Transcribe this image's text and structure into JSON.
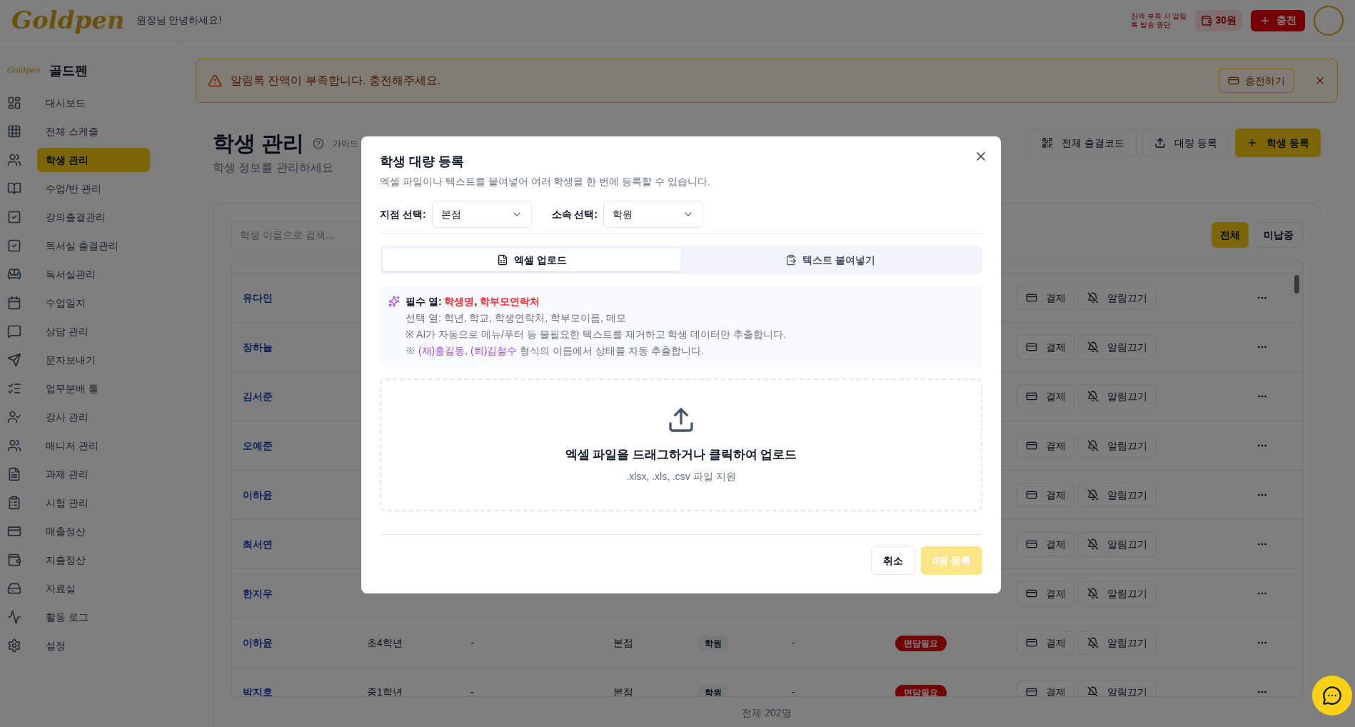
{
  "topbar": {
    "logo": "Goldpen",
    "greeting": "원장님 안녕하세요!",
    "balance_notice": [
      "잔액 부족 시 알림",
      "톡 발송 중단"
    ],
    "balance": "30원",
    "charge_button": "충전"
  },
  "sidebar": {
    "brand": "골드펜",
    "brand_logo": "Goldpen",
    "items": [
      {
        "label": "대시보드",
        "selected": false
      },
      {
        "label": "전체 스케줄",
        "selected": false
      },
      {
        "label": "학생 관리",
        "selected": true
      },
      {
        "label": "수업/반 관리",
        "selected": false
      },
      {
        "label": "강의출결관리",
        "selected": false
      },
      {
        "label": "독서실 출결관리",
        "selected": false
      },
      {
        "label": "독서실관리",
        "selected": false
      },
      {
        "label": "수업일지",
        "selected": false
      },
      {
        "label": "상담 관리",
        "selected": false
      },
      {
        "label": "문자보내기",
        "selected": false
      },
      {
        "label": "업무분배 툴",
        "selected": false
      },
      {
        "label": "강사 관리",
        "selected": false
      },
      {
        "label": "매니저 관리",
        "selected": false
      },
      {
        "label": "과제 관리",
        "selected": false
      },
      {
        "label": "시험 관리",
        "selected": false
      },
      {
        "label": "매출정산",
        "selected": false
      },
      {
        "label": "지출정산",
        "selected": false
      },
      {
        "label": "자료실",
        "selected": false
      },
      {
        "label": "활동 로그",
        "selected": false
      },
      {
        "label": "설정",
        "selected": false
      }
    ]
  },
  "alert": {
    "message": "알림톡 잔액이 부족합니다. 충전해주세요.",
    "action": "충전하기"
  },
  "page": {
    "title": "학생 관리",
    "guide": "가이드",
    "subtitle": "학생 정보를 관리하세요",
    "actions": [
      "전체 출결코드",
      "대량 등록",
      "학생 등록"
    ]
  },
  "search": {
    "placeholder": "학생 이름으로 검색..."
  },
  "filters": [
    {
      "label": "전체",
      "selected": true
    },
    {
      "label": "미납중",
      "selected": false
    }
  ],
  "rows": [
    {
      "name": "유다인",
      "pay": "결제",
      "mute": "알림끄기"
    },
    {
      "name": "장하늘",
      "pay": "결제",
      "mute": "알림끄기"
    },
    {
      "name": "김서준",
      "pay": "결제",
      "mute": "알림끄기"
    },
    {
      "name": "오예준",
      "pay": "결제",
      "mute": "알림끄기"
    },
    {
      "name": "이하윤",
      "pay": "결제",
      "mute": "알림끄기"
    },
    {
      "name": "최서연",
      "pay": "결제",
      "mute": "알림끄기"
    },
    {
      "name": "한지우",
      "pay": "결제",
      "mute": "알림끄기"
    },
    {
      "name": "이하윤",
      "grade": "초4학년",
      "column_3": "-",
      "branch": "본점",
      "affiliation": "학원",
      "column_6": "-",
      "status": "면담필요",
      "pay": "결제",
      "mute": "알림끄기"
    },
    {
      "name": "박지호",
      "grade": "중1학년",
      "column_3": "-",
      "branch": "본점",
      "affiliation": "학원",
      "column_6": "-",
      "status": "면담필요",
      "pay": "결제",
      "mute": "알림끄기"
    }
  ],
  "total": "전체 202명",
  "dialog": {
    "title": "학생 대량 등록",
    "description": "엑셀 파일이나 텍스트를 붙여넣어 여러 학생을 한 번에 등록할 수 있습니다.",
    "selects": [
      {
        "label": "지점 선택:",
        "value": "본점"
      },
      {
        "label": "소속 선택:",
        "value": "학원"
      }
    ],
    "tabs": [
      {
        "label": "엑셀 업로드",
        "selected": true
      },
      {
        "label": "텍스트 붙여넣기",
        "selected": false
      }
    ],
    "info": {
      "required": "필수 열: **학생명**, **학부모연락처**",
      "optional": "선택 열: 학년, 학교, 학생연락처, 학부모이름, 메모",
      "note_1": "※ AI가 자동으로 메뉴/푸터 등 불필요한 텍스트를 제거하고 학생 데이터만 추출합니다.",
      "note_2": "※ *(재)홍길동*, *(퇴)김철수* 형식의 이름에서 상태를 자동 추출합니다."
    },
    "dropzone": {
      "title": "엑셀 파일을 드래그하거나 클릭하여 업로드",
      "hint": ".xlsx, .xls, .csv 파일 지원"
    },
    "cancel": "취소",
    "submit": {
      "label": "0명 등록",
      "disabled": true
    }
  }
}
